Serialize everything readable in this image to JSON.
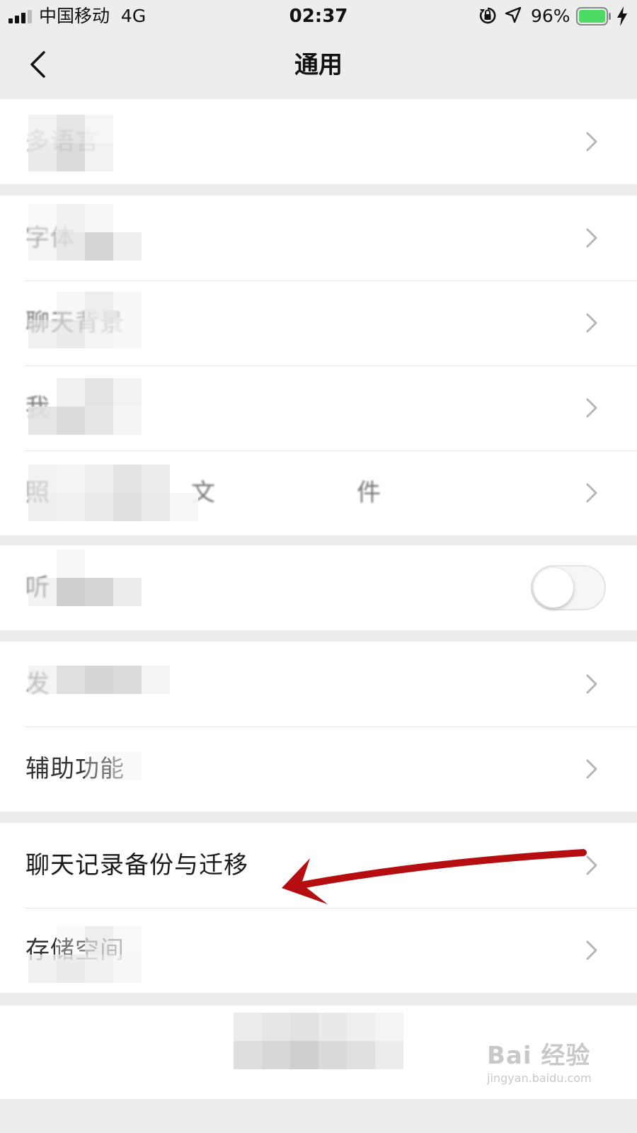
{
  "status_bar": {
    "carrier": "中国移动",
    "network": "4G",
    "time": "02:37",
    "battery_percent": "96%",
    "battery_color": "#4cd964",
    "icons": [
      "signal-bars-icon",
      "orientation-lock-icon",
      "location-arrow-icon",
      "battery-icon",
      "charging-bolt-icon"
    ]
  },
  "nav": {
    "title": "通用",
    "back_icon": "chevron-left-icon"
  },
  "groups": [
    {
      "items": [
        {
          "label": "多语言",
          "blurred": true
        }
      ]
    },
    {
      "items": [
        {
          "label": "字体",
          "blurred": true
        },
        {
          "label": "聊天背景",
          "blurred": true
        },
        {
          "label": "我",
          "blurred": true
        },
        {
          "label": "照文件",
          "blurred": true
        }
      ]
    },
    {
      "items": [
        {
          "label": "听",
          "blurred": true,
          "toggle": false
        }
      ]
    },
    {
      "items": [
        {
          "label": "发",
          "blurred": true
        },
        {
          "label": "辅助功能",
          "blurred": false
        }
      ]
    },
    {
      "items": [
        {
          "label": "聊天记录备份与迁移",
          "blurred": false
        },
        {
          "label": "存储空间",
          "blurred": false
        }
      ]
    }
  ],
  "annotation": {
    "color": "#b50d10",
    "points_to": "聊天记录备份与迁移"
  },
  "watermark": {
    "brand": "Bai 经验",
    "url": "jingyan.baidu.com"
  }
}
